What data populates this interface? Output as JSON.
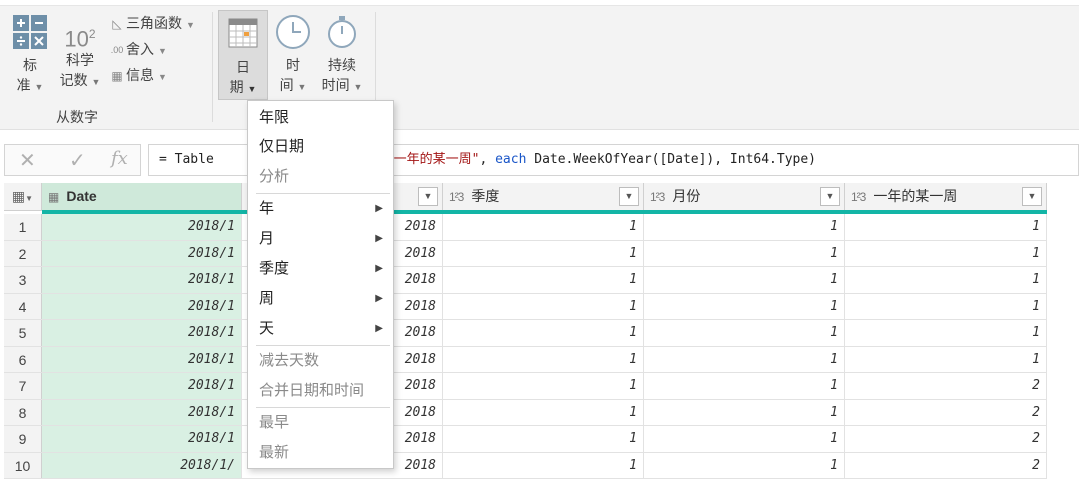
{
  "ribbon": {
    "standard": {
      "line1": "标",
      "line2": "准"
    },
    "scientific": {
      "big": "10",
      "sup": "2",
      "line1": "科学",
      "line2": "记数"
    },
    "trig": "三角函数",
    "round": "舍入",
    "info": "信息",
    "date": {
      "line1": "日",
      "line2": "期"
    },
    "time": {
      "line1": "时",
      "line2": "间"
    },
    "duration": {
      "line1": "持续",
      "line2": "时间"
    },
    "group_label": "从数字"
  },
  "formula": {
    "cancel": "✕",
    "confirm": "✓",
    "fx": "fx",
    "part1": "= Table",
    "str": "\"一年的某一周\"",
    "part2": ", ",
    "kw": "each",
    "part3": " Date.WeekOfYear([Date]), Int64.Type)"
  },
  "table": {
    "headers": {
      "date": "Date",
      "quarter": "季度",
      "month": "月份",
      "week": "一年的某一周",
      "type_int": "1²3"
    },
    "rows": [
      {
        "n": "1",
        "date": "2018/1",
        "year": "2018",
        "q": "1",
        "m": "1",
        "w": "1"
      },
      {
        "n": "2",
        "date": "2018/1",
        "year": "2018",
        "q": "1",
        "m": "1",
        "w": "1"
      },
      {
        "n": "3",
        "date": "2018/1",
        "year": "2018",
        "q": "1",
        "m": "1",
        "w": "1"
      },
      {
        "n": "4",
        "date": "2018/1",
        "year": "2018",
        "q": "1",
        "m": "1",
        "w": "1"
      },
      {
        "n": "5",
        "date": "2018/1",
        "year": "2018",
        "q": "1",
        "m": "1",
        "w": "1"
      },
      {
        "n": "6",
        "date": "2018/1",
        "year": "2018",
        "q": "1",
        "m": "1",
        "w": "1"
      },
      {
        "n": "7",
        "date": "2018/1",
        "year": "2018",
        "q": "1",
        "m": "1",
        "w": "2"
      },
      {
        "n": "8",
        "date": "2018/1",
        "year": "2018",
        "q": "1",
        "m": "1",
        "w": "2"
      },
      {
        "n": "9",
        "date": "2018/1",
        "year": "2018",
        "q": "1",
        "m": "1",
        "w": "2"
      },
      {
        "n": "10",
        "date": "2018/1/",
        "year": "2018",
        "q": "1",
        "m": "1",
        "w": "2"
      }
    ]
  },
  "menu": {
    "items": [
      {
        "label": "年限",
        "disabled": false,
        "sub": false
      },
      {
        "label": "仅日期",
        "disabled": false,
        "sub": false
      },
      {
        "label": "分析",
        "disabled": true,
        "sub": false
      },
      {
        "label": "年",
        "disabled": false,
        "sub": true
      },
      {
        "label": "月",
        "disabled": false,
        "sub": true
      },
      {
        "label": "季度",
        "disabled": false,
        "sub": true
      },
      {
        "label": "周",
        "disabled": false,
        "sub": true
      },
      {
        "label": "天",
        "disabled": false,
        "sub": true
      },
      {
        "label": "减去天数",
        "disabled": true,
        "sub": false
      },
      {
        "label": "合并日期和时间",
        "disabled": true,
        "sub": false
      },
      {
        "label": "最早",
        "disabled": true,
        "sub": false
      },
      {
        "label": "最新",
        "disabled": true,
        "sub": false
      }
    ]
  },
  "colors": {
    "accent_teal": "#13b5a6",
    "date_column_bg": "#d9f0e3",
    "string_red": "#a31515",
    "keyword_blue": "#1a56c8"
  }
}
